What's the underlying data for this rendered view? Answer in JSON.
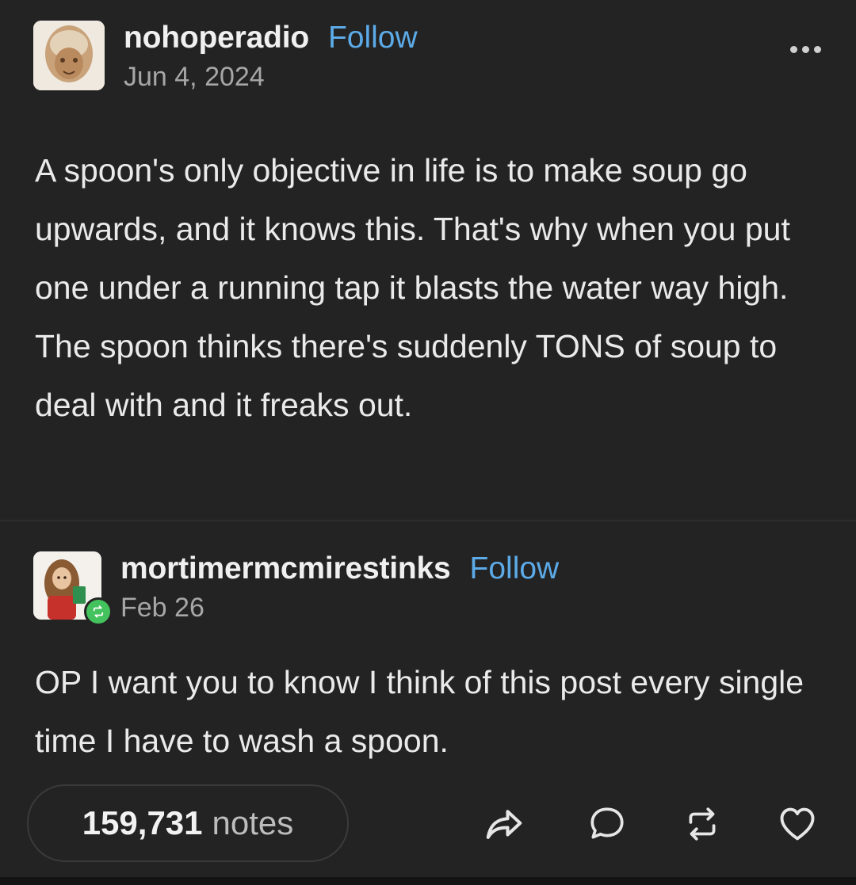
{
  "op": {
    "username": "nohoperadio",
    "follow_label": "Follow",
    "date": "Jun 4, 2024",
    "text": "A spoon's only objective in life is to make soup go upwards, and it knows this. That's why when you put one under a running tap it blasts the water way high. The spoon thinks there's suddenly TONS of soup to deal with and it freaks out."
  },
  "reblog": {
    "username": "mortimermcmirestinks",
    "follow_label": "Follow",
    "date": "Feb 26",
    "text": "OP I want you to know I think of this post every single time I have to wash a spoon."
  },
  "footer": {
    "notes_count": "159,731",
    "notes_label": "notes",
    "actions": [
      "share-icon",
      "reply-icon",
      "reblog-icon",
      "like-icon"
    ]
  },
  "colors": {
    "background": "#232323",
    "follow": "#5cabe8",
    "reblog_badge": "#44c25d"
  }
}
